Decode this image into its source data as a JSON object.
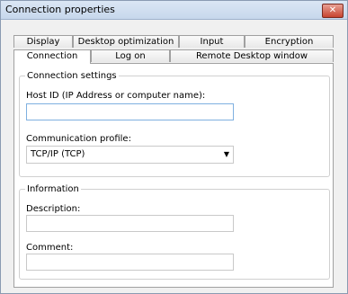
{
  "window": {
    "title": "Connection properties",
    "close_icon": "close-x-icon"
  },
  "tabs_back": [
    "Display",
    "Desktop optimization",
    "Input",
    "Encryption"
  ],
  "tabs_front": [
    "Connection",
    "Log on",
    "Remote Desktop window"
  ],
  "connection_settings": {
    "legend": "Connection settings",
    "host_label": "Host ID (IP Address or computer name):",
    "host_value": "",
    "profile_label": "Communication profile:",
    "profile_value": "TCP/IP (TCP)"
  },
  "information": {
    "legend": "Information",
    "description_label": "Description:",
    "description_value": "",
    "comment_label": "Comment:",
    "comment_value": ""
  }
}
